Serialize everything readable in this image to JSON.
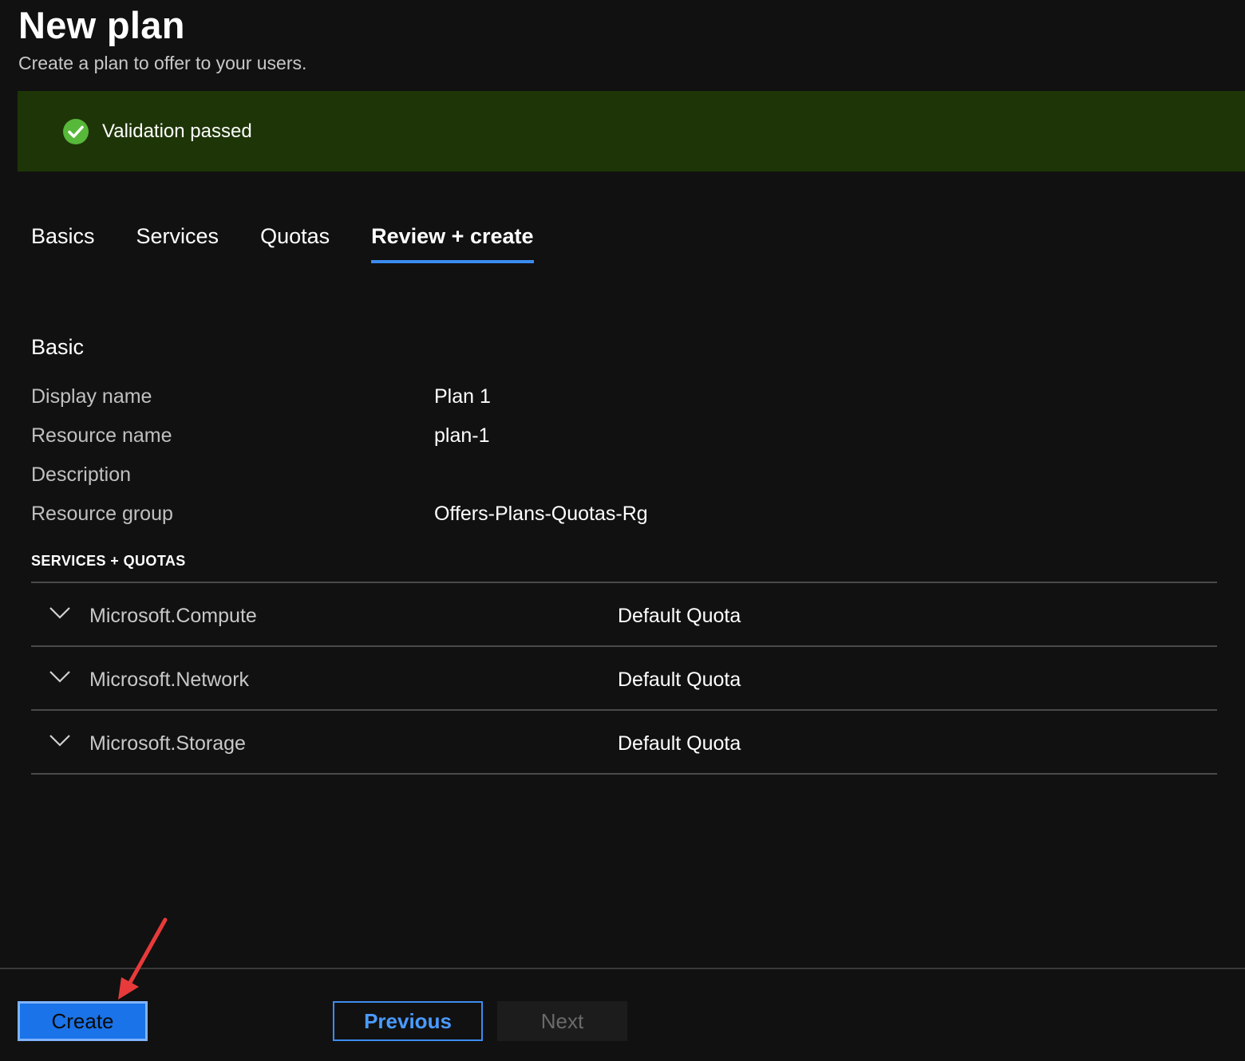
{
  "header": {
    "title": "New plan",
    "subtitle": "Create a plan to offer to your users."
  },
  "banner": {
    "icon": "check-circle-icon",
    "text": "Validation passed",
    "bg_color": "#1e3507",
    "icon_color": "#57b83a"
  },
  "tabs": [
    {
      "label": "Basics",
      "active": false
    },
    {
      "label": "Services",
      "active": false
    },
    {
      "label": "Quotas",
      "active": false
    },
    {
      "label": "Review + create",
      "active": true
    }
  ],
  "basic": {
    "section_title": "Basic",
    "fields": [
      {
        "label": "Display name",
        "value": "Plan 1"
      },
      {
        "label": "Resource name",
        "value": "plan-1"
      },
      {
        "label": "Description",
        "value": ""
      },
      {
        "label": "Resource group",
        "value": "Offers-Plans-Quotas-Rg"
      }
    ]
  },
  "services_quotas": {
    "section_title": "SERVICES + QUOTAS",
    "rows": [
      {
        "service": "Microsoft.Compute",
        "quota": "Default Quota"
      },
      {
        "service": "Microsoft.Network",
        "quota": "Default Quota"
      },
      {
        "service": "Microsoft.Storage",
        "quota": "Default Quota"
      }
    ]
  },
  "footer": {
    "create_label": "Create",
    "previous_label": "Previous",
    "next_label": "Next"
  },
  "colors": {
    "accent": "#3c8cf0",
    "background": "#111111",
    "annotation_arrow": "#e83a3a"
  }
}
